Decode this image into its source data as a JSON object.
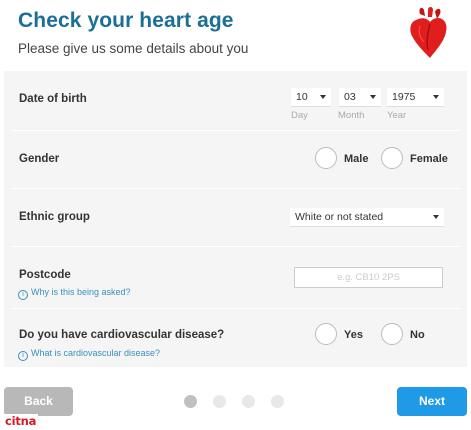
{
  "header": {
    "title": "Check your heart age",
    "subtitle": "Please give us some details about you",
    "logo_icon": "heart-icon"
  },
  "dob": {
    "label": "Date of birth",
    "day": {
      "value": "10",
      "sublabel": "Day"
    },
    "month": {
      "value": "03",
      "sublabel": "Month"
    },
    "year": {
      "value": "1975",
      "sublabel": "Year"
    }
  },
  "gender": {
    "label": "Gender",
    "options": [
      "Male",
      "Female"
    ]
  },
  "ethnic": {
    "label": "Ethnic group",
    "value": "White or not stated"
  },
  "postcode": {
    "label": "Postcode",
    "placeholder": "e.g. CB10 2PS",
    "help": "Why is this being asked?"
  },
  "cvd": {
    "label": "Do you have cardiovascular disease?",
    "options": [
      "Yes",
      "No"
    ],
    "help": "What is cardiovascular disease?"
  },
  "footer": {
    "back": "Back",
    "next": "Next",
    "step_current": 1,
    "step_total": 4
  },
  "watermark": "citna",
  "colors": {
    "title": "#1b6f97",
    "next_button": "#1e9ae6",
    "back_button": "#b8b8b8",
    "help_link": "#3a8fc5",
    "panel": "#f5f5f5",
    "heart": "#e01e1e"
  }
}
